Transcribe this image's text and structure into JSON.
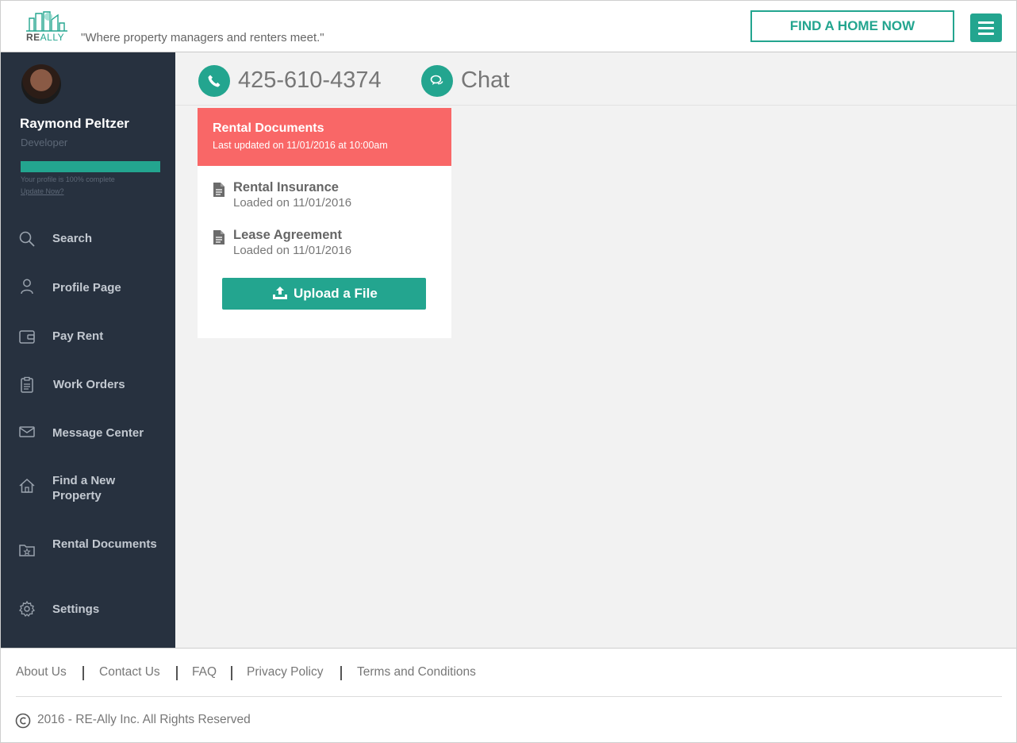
{
  "header": {
    "logo_text_bold": "RE",
    "logo_text_light": "ALLY",
    "tagline": "\"Where property managers and renters meet.\"",
    "find_home_label": "FIND A HOME NOW",
    "menu_icon": "hamburger-icon"
  },
  "colors": {
    "brand": "#23a58f",
    "sidebar_bg": "#27313f",
    "card_header": "#f96767"
  },
  "user": {
    "name": "Raymond Peltzer",
    "role": "Developer",
    "profile_complete": 1.0,
    "profile_note": "Your profile is 100% complete",
    "update_link": "Update Now?"
  },
  "sidebar": {
    "items": [
      {
        "label": "Search",
        "icon": "search-icon"
      },
      {
        "label": "Profile Page",
        "icon": "user-icon"
      },
      {
        "label": "Pay Rent",
        "icon": "wallet-icon"
      },
      {
        "label": "Work Orders",
        "icon": "clipboard-icon"
      },
      {
        "label": "Message Center",
        "icon": "mail-icon"
      },
      {
        "label": "Find a New Property",
        "icon": "home-icon"
      },
      {
        "label": "Rental Documents",
        "icon": "folder-icon"
      },
      {
        "label": "Settings",
        "icon": "gear-icon"
      }
    ]
  },
  "contact": {
    "phone": "425-610-4374",
    "chat": "Chat"
  },
  "documents_card": {
    "title": "Rental Documents",
    "subtitle": "Last updated on 11/01/2016 at 10:00am",
    "documents": [
      {
        "name": "Rental Insurance",
        "date": "Loaded on 11/01/2016"
      },
      {
        "name": "Lease Agreement",
        "date": "Loaded on 11/01/2016"
      }
    ],
    "upload_label": "Upload a File"
  },
  "footer": {
    "links": [
      "About Us",
      "Contact Us",
      "FAQ",
      "Privacy Policy",
      "Terms and Conditions"
    ],
    "copyright": "2016 - RE-Ally Inc. All Rights Reserved"
  }
}
